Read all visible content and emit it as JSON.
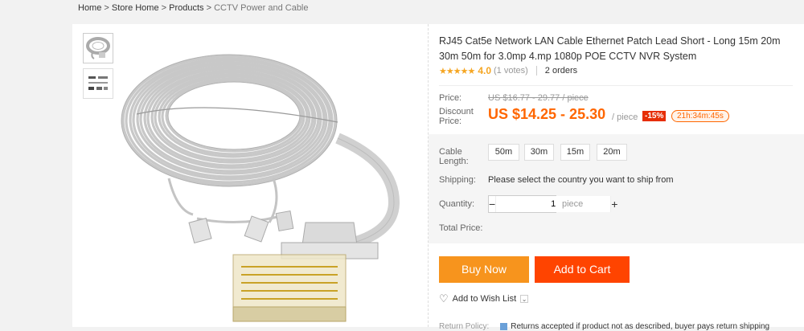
{
  "breadcrumb": {
    "items": [
      "Home",
      "Store Home",
      "Products",
      "CCTV Power and Cable"
    ],
    "separator": " > "
  },
  "product": {
    "title": "RJ45 Cat5e Network LAN Cable Ethernet Patch Lead Short - Long 15m 20m 30m 50m for 3.0mp 4.mp 1080p POE CCTV NVR System",
    "rating": {
      "stars": "★★★★★",
      "score": "4.0",
      "votes": "(1 votes)",
      "star_value": 4,
      "star_max": 5
    },
    "orders": "2 orders"
  },
  "price": {
    "price_label": "Price:",
    "original": "US $16.77 - 29.77 / piece",
    "discount_label": "Discount Price:",
    "current": "US $14.25 - 25.30",
    "unit": "/ piece",
    "discount_badge": "-15%",
    "timer": "21h:34m:45s"
  },
  "options": {
    "length_label": "Cable Length:",
    "lengths": [
      "50m",
      "30m",
      "15m",
      "20m"
    ],
    "shipping_label": "Shipping:",
    "shipping_text": "Please select the country you want to ship from",
    "quantity_label": "Quantity:",
    "quantity_value": "1",
    "quantity_minus": "−",
    "quantity_plus": "+",
    "quantity_unit": "piece",
    "total_label": "Total Price:"
  },
  "actions": {
    "buy_now": "Buy Now",
    "add_to_cart": "Add to Cart",
    "wishlist": "Add to Wish List"
  },
  "return_policy": {
    "label": "Return Policy:",
    "text": "Returns accepted if product not as described, buyer pays return shipping"
  },
  "colors": {
    "accent": "#ff6600",
    "buy_now": "#f7941d",
    "add_to_cart": "#ff4400",
    "stars": "#f5a623",
    "discount_badge": "#e62e04"
  },
  "icons": {
    "wishlist": "heart-icon",
    "dropdown": "chevron-down-icon",
    "return": "return-policy-icon"
  }
}
